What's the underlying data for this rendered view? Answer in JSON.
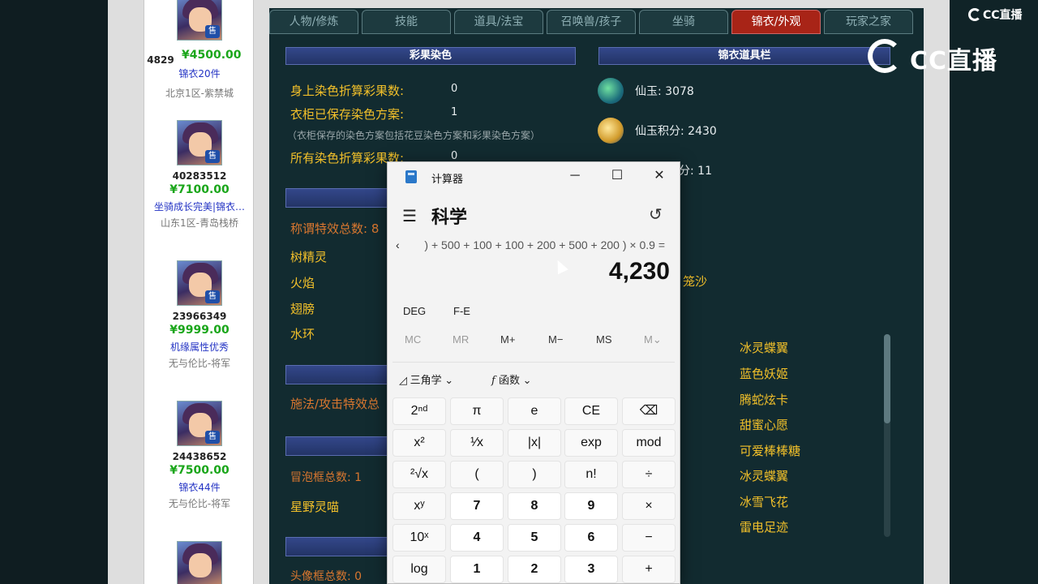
{
  "watermark": {
    "small": "CC直播",
    "large": "CC直播"
  },
  "sellers": [
    {
      "id": "4829",
      "price": "¥4500.00",
      "desc": "锦衣20件",
      "server": "北京1区-紫禁城",
      "badge": "售"
    },
    {
      "id": "40283512",
      "price": "¥7100.00",
      "desc": "坐骑成长完美|锦衣…",
      "server": "山东1区-青岛栈桥",
      "badge": "售"
    },
    {
      "id": "23966349",
      "price": "¥9999.00",
      "desc": "机缘属性优秀",
      "server": "无与伦比-将军",
      "badge": "售"
    },
    {
      "id": "24438652",
      "price": "¥7500.00",
      "desc": "锦衣44件",
      "server": "无与伦比-将军",
      "badge": "售"
    }
  ],
  "tabs": [
    "人物/修炼",
    "技能",
    "道具/法宝",
    "召唤兽/孩子",
    "坐骑",
    "锦衣/外观",
    "玩家之家"
  ],
  "dye": {
    "header": "彩果染色",
    "rows": [
      {
        "label": "身上染色折算彩果数:",
        "value": "0"
      },
      {
        "label": "衣柜已保存染色方案:",
        "value": "1"
      }
    ],
    "note": "（衣柜保存的染色方案包括花豆染色方案和彩果染色方案）",
    "total_label": "所有染色折算彩果数:",
    "total_value": "0"
  },
  "title_section": {
    "count_label": "称谓特效总数: 8",
    "items": [
      "树精灵",
      "火焰",
      "翅膀",
      "水环"
    ]
  },
  "cast_label": "施法/攻击特效总",
  "bubble_label": "冒泡框总数: 1",
  "bubble_item": "星野灵喵",
  "avatar_frame_label": "头像框总数: 0",
  "wardrobe": {
    "header": "锦衣道具栏",
    "rows": [
      {
        "label": "仙玉: 3078"
      },
      {
        "label": "仙玉积分: 2430"
      },
      {
        "label": "分: 11"
      }
    ],
    "extra": "笼沙",
    "list": [
      "冰灵蝶翼",
      "蓝色妖姬",
      "腾蛇炫卡",
      "甜蜜心愿",
      "可爱棒棒糖",
      "冰灵蝶翼",
      "冰雪飞花",
      "雷电足迹"
    ]
  },
  "calculator": {
    "window_title": "计算器",
    "mode": "科学",
    "expression": ") + 500 + 100 + 100 + 200 + 500 + 200 ) × 0.9 =",
    "result": "4,230",
    "angle": "DEG",
    "fe": "F-E",
    "memory": [
      "MC",
      "MR",
      "M+",
      "M−",
      "MS",
      "M⌄"
    ],
    "trig": "三角学",
    "func": "函数",
    "keys": [
      [
        "2ⁿᵈ",
        "π",
        "e",
        "CE",
        "⌫"
      ],
      [
        "x²",
        "¹⁄x",
        "|x|",
        "exp",
        "mod"
      ],
      [
        "²√x",
        "(",
        ")",
        "n!",
        "÷"
      ],
      [
        "xʸ",
        "7",
        "8",
        "9",
        "×"
      ],
      [
        "10ˣ",
        "4",
        "5",
        "6",
        "−"
      ],
      [
        "log",
        "1",
        "2",
        "3",
        "+"
      ]
    ]
  }
}
